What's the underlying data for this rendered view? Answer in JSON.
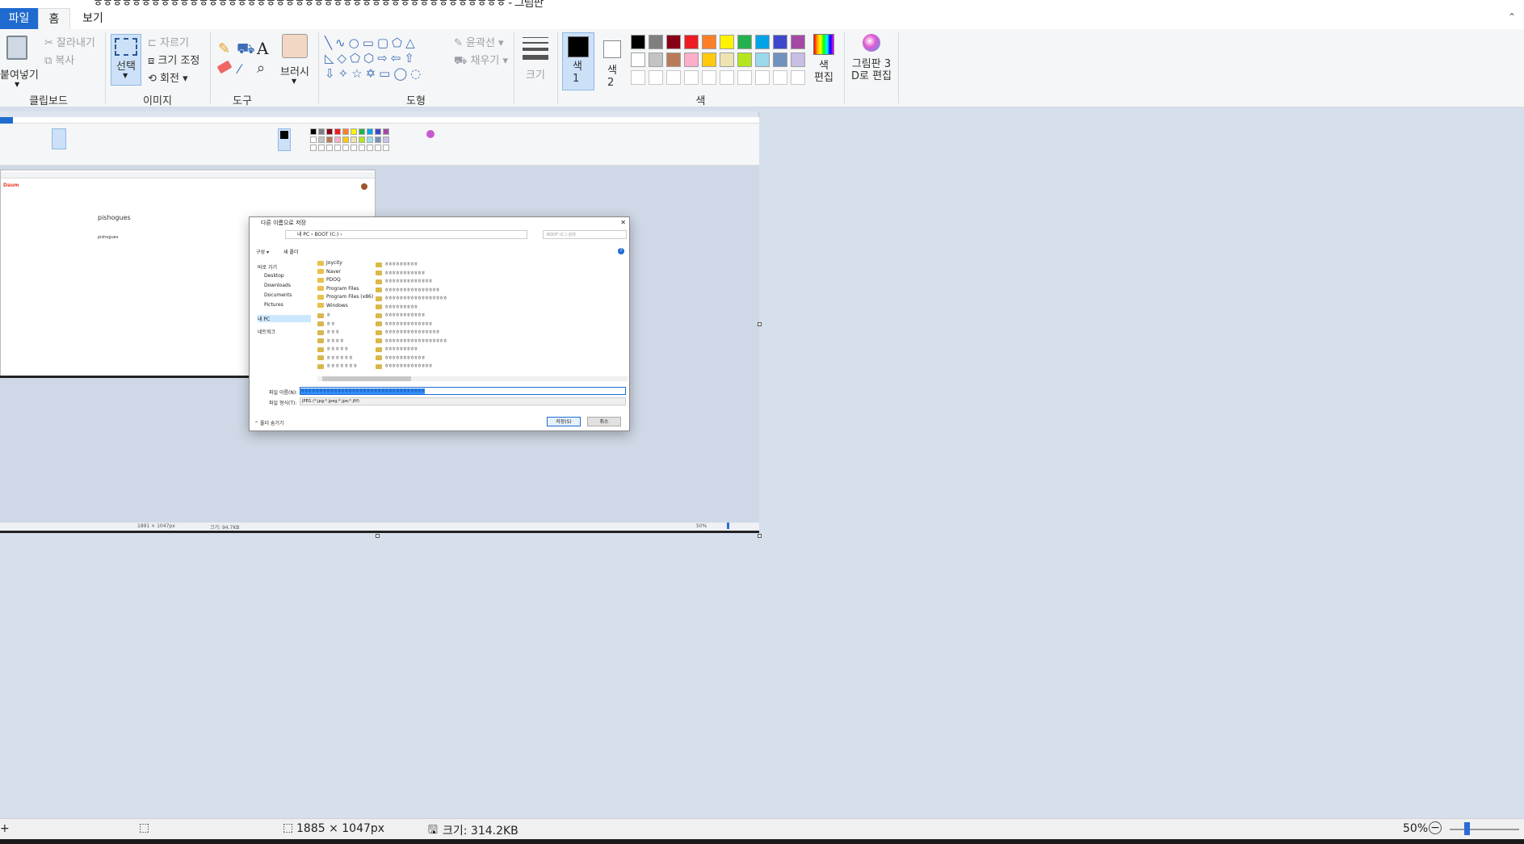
{
  "window": {
    "title": "ㅎㅎㅎㅎㅎㅎㅎㅎㅎㅎㅎㅎㅎㅎㅎㅎㅎㅎㅎㅎㅎㅎㅎㅎㅎㅎㅎㅎㅎㅎㅎㅎㅎㅎㅎㅎㅎㅎㅎㅎㅎㅎㅎ - 그림판"
  },
  "menu": {
    "file": "파일",
    "home": "홈",
    "view": "보기"
  },
  "ribbon": {
    "clipboard": {
      "paste": "붙여넣기",
      "cut": "잘라내기",
      "copy": "복사",
      "label": "클립보드"
    },
    "image": {
      "select": "선택",
      "crop": "자르기",
      "resize": "크기 조정",
      "rotate": "회전",
      "label": "이미지"
    },
    "tools": {
      "label": "도구",
      "text_glyph": "A"
    },
    "brushes": {
      "label": "브러시"
    },
    "shapes": {
      "outline": "윤곽선",
      "fill": "채우기",
      "label": "도형"
    },
    "size": {
      "label": "크기"
    },
    "colors": {
      "color1": "색\n1",
      "color2": "색\n2",
      "edit": "색\n편집",
      "label": "색",
      "palette_row1": [
        "#000000",
        "#7f7f7f",
        "#880015",
        "#ed1c24",
        "#ff7f27",
        "#fff200",
        "#22b14c",
        "#00a2e8",
        "#3f48cc",
        "#a349a4"
      ],
      "palette_row2": [
        "#ffffff",
        "#c3c3c3",
        "#b97a57",
        "#ffaec9",
        "#ffc90e",
        "#efe4b0",
        "#b5e61d",
        "#99d9ea",
        "#7092be",
        "#c8bfe7"
      ]
    },
    "paint3d": {
      "label": "그림판 3\nD로 편집"
    }
  },
  "inner": {
    "blog_title": "pishogues",
    "blog_sub": "pishogues"
  },
  "dialog": {
    "title": "다른 이름으로 저장",
    "path": [
      "내 PC",
      "BOOT (C:)"
    ],
    "search_placeholder": "BOOT (C:) 검색",
    "organize": "구성 ▾",
    "new_folder": "새 폴더",
    "nav": [
      "바로 가기",
      "Desktop",
      "Downloads",
      "Documents",
      "Pictures",
      "내 PC",
      "네트워크"
    ],
    "folders": [
      "Joycity",
      "Naver",
      "PDOQ",
      "Program Files",
      "Program Files (x86)",
      "Windows"
    ],
    "filename_label": "파일 이름(N):",
    "filename_value": "ㅎㅎㅎㅎㅎㅎㅎㅎㅎㅎㅎㅎㅎㅎㅎㅎㅎㅎㅎㅎㅎㅎㅎㅎㅎㅎㅎㅎㅎㅎㅎㅎㅎㅎ",
    "filetype_label": "파일 형식(T):",
    "filetype_value": "JPEG (*.jpg;*.jpeg;*.jpe;*.jfif)",
    "hide_folders": "폴더 숨기기",
    "save": "저장(S)",
    "cancel": "취소"
  },
  "status": {
    "dimensions": "1885 × 1047px",
    "size": "크기: 314.2KB",
    "zoom": "50%"
  },
  "inner_status": {
    "dimensions": "1891 × 1047px",
    "size": "크기: 94.7KB",
    "zoom": "50%"
  }
}
